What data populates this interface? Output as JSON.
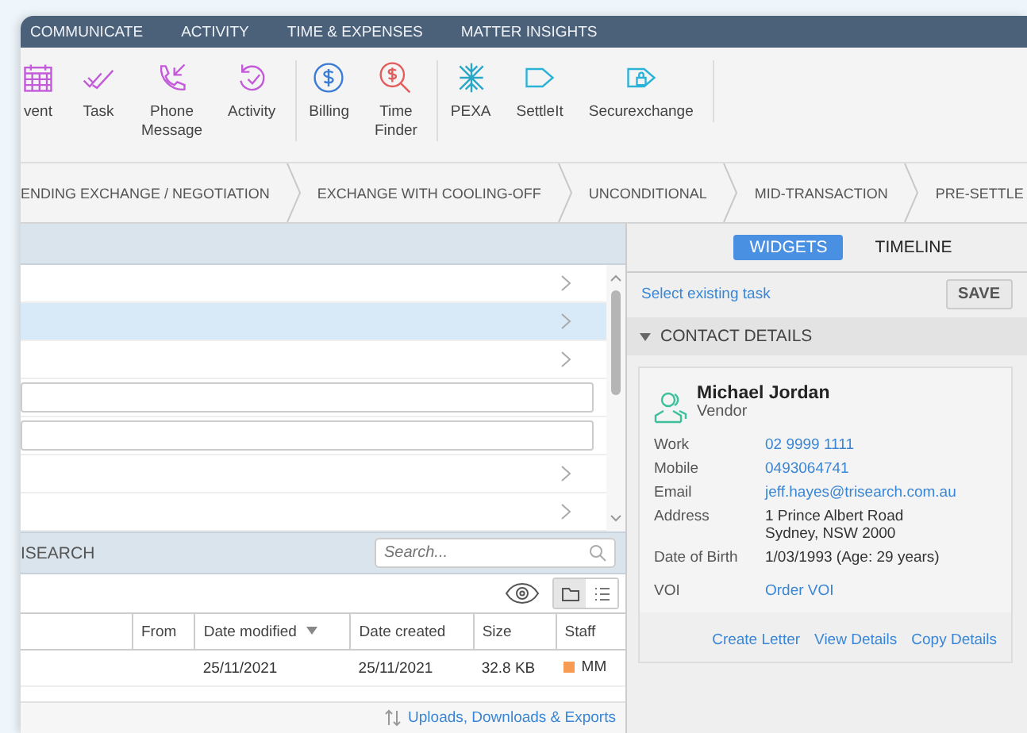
{
  "nav": {
    "tabs": [
      {
        "label": "COMMUNICATE"
      },
      {
        "label": "ACTIVITY"
      },
      {
        "label": "TIME & EXPENSES"
      },
      {
        "label": "MATTER INSIGHTS"
      }
    ]
  },
  "toolbar": {
    "groups": [
      [
        {
          "kind": "calendar",
          "label": "vent"
        },
        {
          "kind": "task",
          "label": "Task"
        },
        {
          "kind": "phone",
          "label": "Phone Message"
        },
        {
          "kind": "activity",
          "label": "Activity"
        }
      ],
      [
        {
          "kind": "billing",
          "label": "Billing"
        },
        {
          "kind": "timefinder",
          "label": "Time Finder"
        }
      ],
      [
        {
          "kind": "pexa",
          "label": "PEXA"
        },
        {
          "kind": "settleit",
          "label": "SettleIt"
        },
        {
          "kind": "secure",
          "label": "Securexchange"
        }
      ]
    ]
  },
  "stages": [
    {
      "label": "ENDING EXCHANGE / NEGOTIATION"
    },
    {
      "label": "EXCHANGE WITH COOLING-OFF"
    },
    {
      "label": "UNCONDITIONAL"
    },
    {
      "label": "MID-TRANSACTION"
    },
    {
      "label": "PRE-SETTLE"
    }
  ],
  "list": {
    "rows": [
      {
        "kind": "link",
        "selected": false
      },
      {
        "kind": "link",
        "selected": true
      },
      {
        "kind": "link",
        "selected": false
      },
      {
        "kind": "field",
        "selected": false
      },
      {
        "kind": "field",
        "selected": false
      },
      {
        "kind": "link",
        "selected": false
      },
      {
        "kind": "link",
        "selected": false
      }
    ]
  },
  "documents": {
    "title": "ISEARCH",
    "search": {
      "placeholder": "Search..."
    },
    "view_toggle": [
      {
        "kind": "folder",
        "selected": true
      },
      {
        "kind": "list",
        "selected": false
      }
    ],
    "table": {
      "columns": [
        {
          "label": "From",
          "sorted": false
        },
        {
          "label": "Date modified",
          "sorted": true
        },
        {
          "label": "Date created",
          "sorted": false
        },
        {
          "label": "Size",
          "sorted": false
        },
        {
          "label": "Staff",
          "sorted": false
        }
      ],
      "rows": [
        {
          "date_modified": "25/11/2021",
          "date_created": "25/11/2021",
          "size": "32.8 KB",
          "staff": {
            "initials": "MM",
            "color": "#f79a52"
          }
        }
      ]
    },
    "footer_link": "Uploads, Downloads & Exports"
  },
  "side": {
    "tabs": [
      {
        "label": "WIDGETS",
        "selected": true
      },
      {
        "label": "TIMELINE",
        "selected": false
      }
    ],
    "task_link": "Select existing task",
    "save": "SAVE",
    "section": {
      "title": "CONTACT DETAILS",
      "expanded": true
    },
    "contact": {
      "name": "Michael Jordan",
      "role": "Vendor",
      "fields": [
        {
          "label": "Work",
          "kind": "link",
          "lines": [
            "02 9999 1111"
          ]
        },
        {
          "label": "Mobile",
          "kind": "link",
          "lines": [
            "0493064741"
          ]
        },
        {
          "label": "Email",
          "kind": "link",
          "lines": [
            "jeff.hayes@trisearch.com.au"
          ]
        },
        {
          "label": "Address",
          "kind": "text",
          "lines": [
            "1 Prince Albert Road",
            "Sydney, NSW 2000"
          ]
        },
        {
          "label": "Date of Birth",
          "kind": "text",
          "lines": [
            "1/03/1993 (Age: 29 years)"
          ]
        },
        {
          "label": "VOI",
          "kind": "link",
          "lines": [
            "Order VOI"
          ]
        }
      ],
      "actions": [
        "Create Letter",
        "View Details",
        "Copy Details"
      ]
    }
  }
}
